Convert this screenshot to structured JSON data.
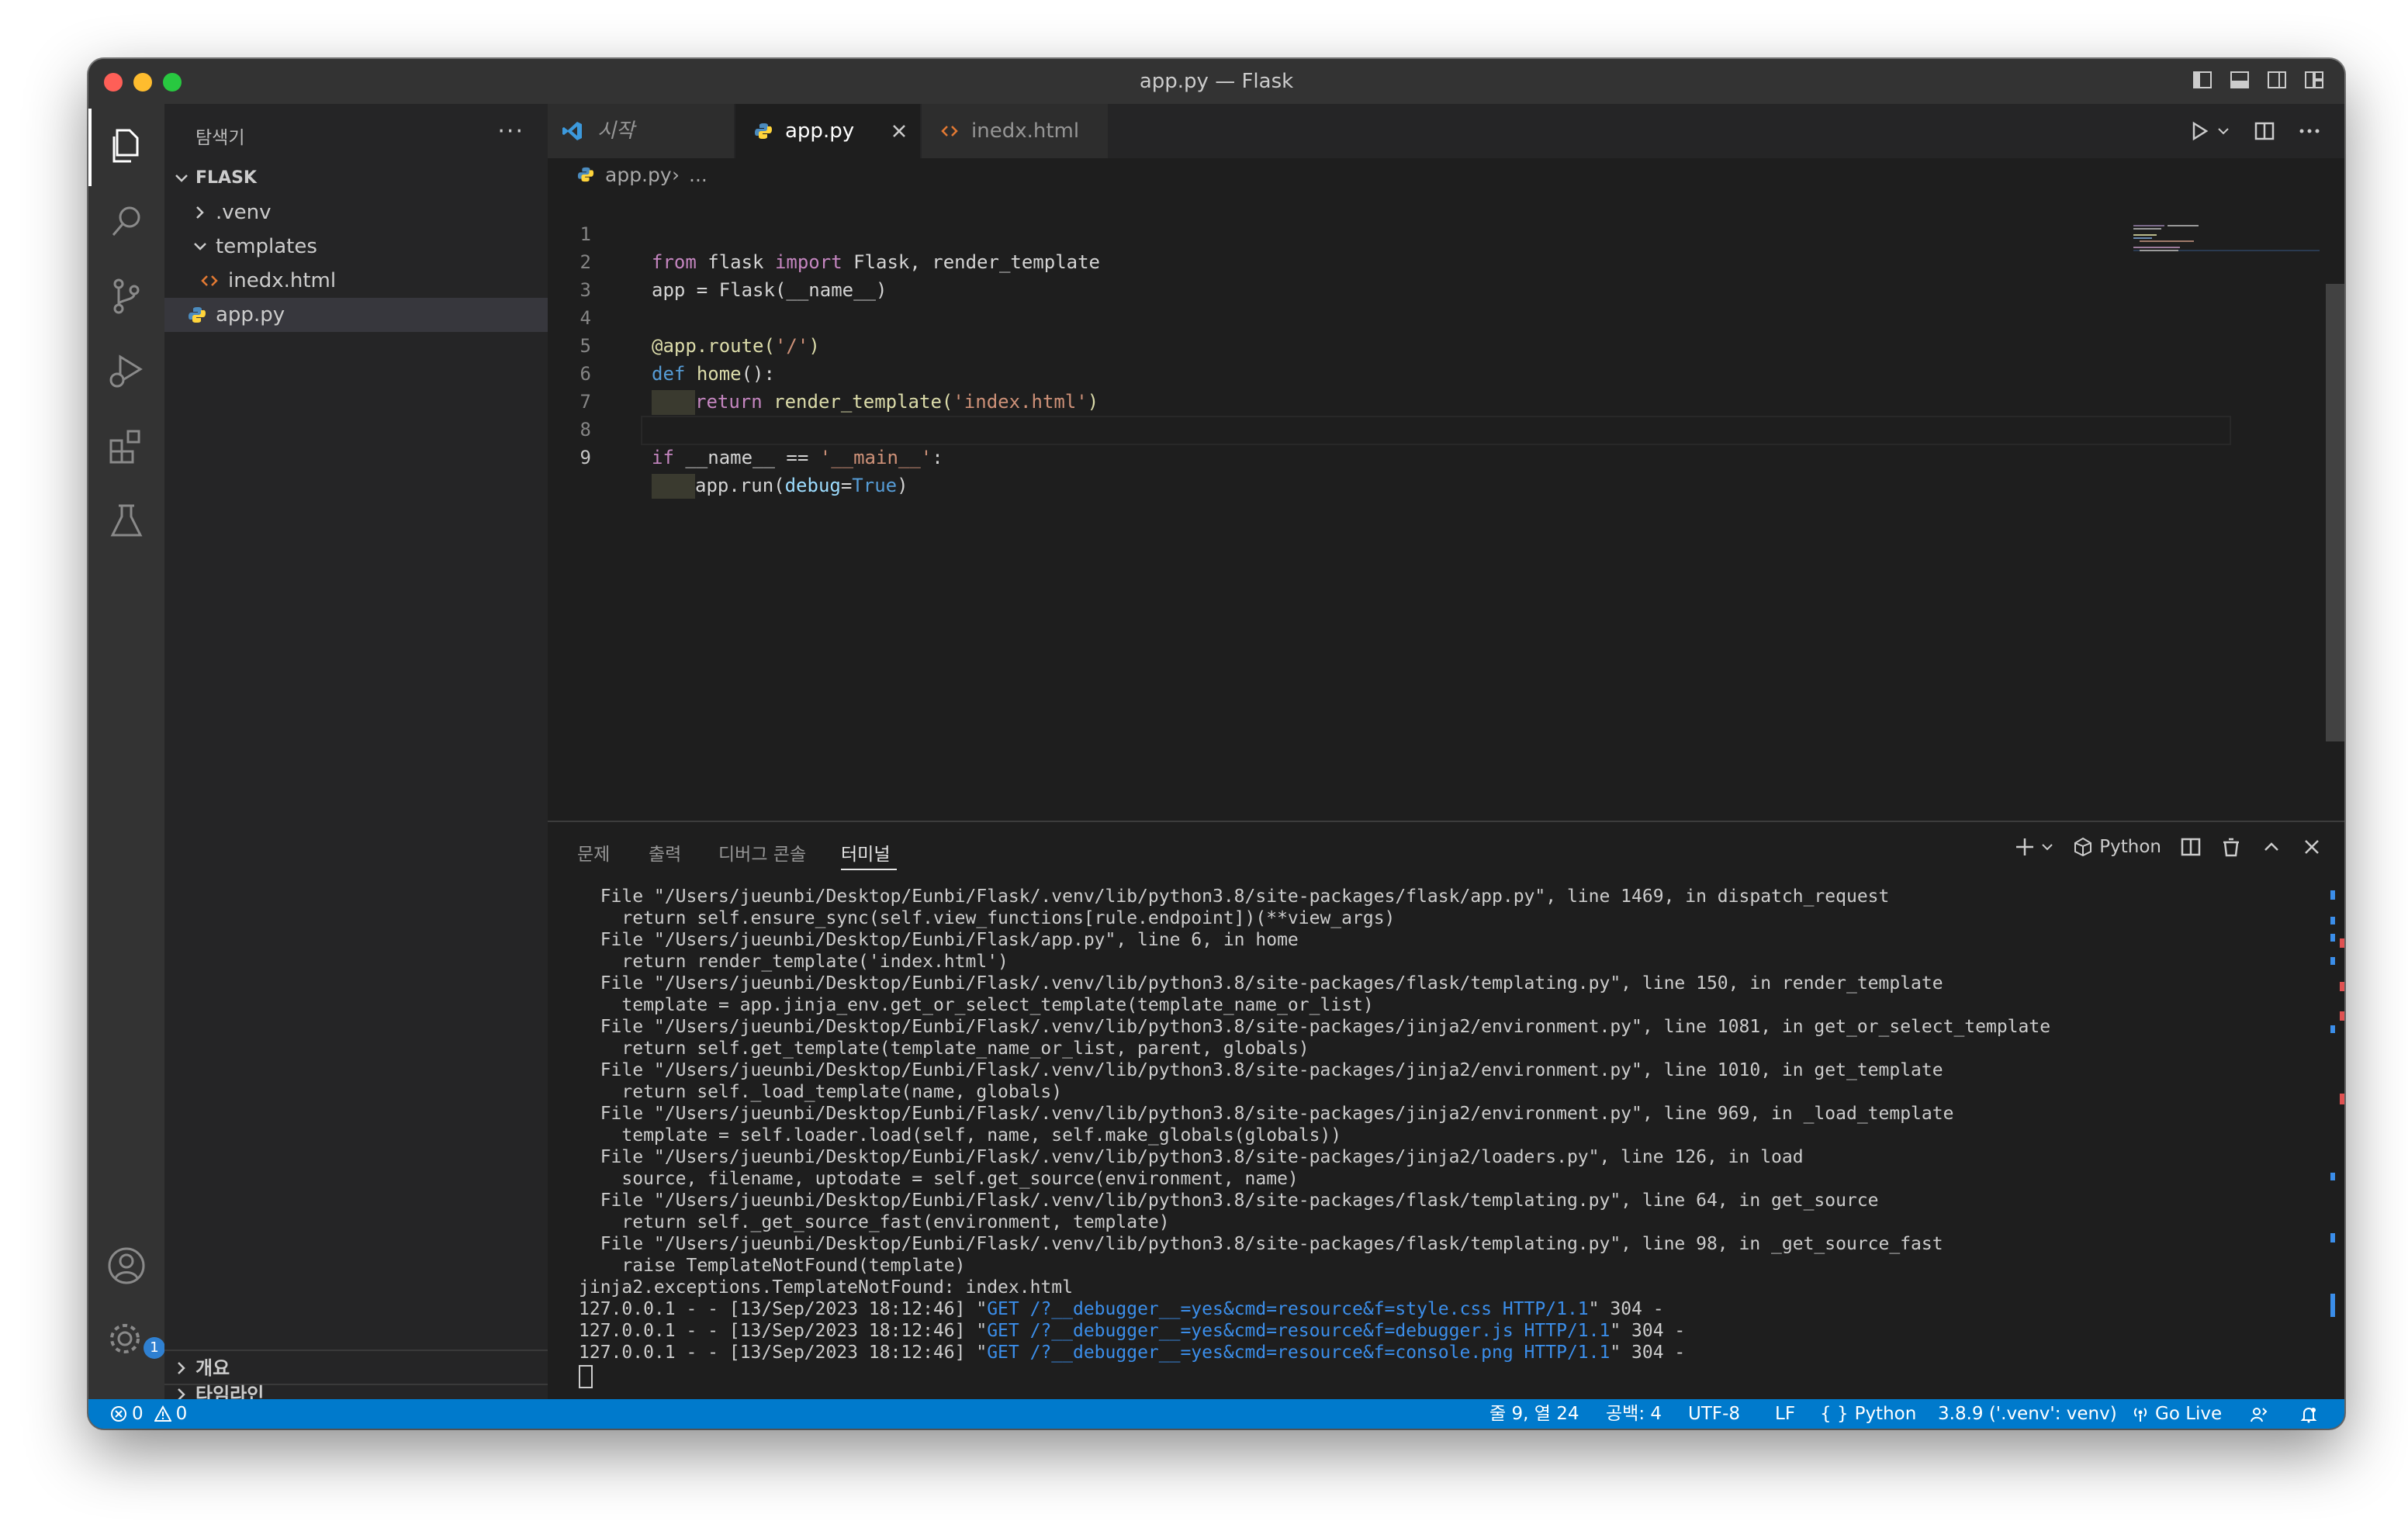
{
  "window": {
    "title": "app.py — Flask"
  },
  "sidebar": {
    "header": "탐색기",
    "more": "···",
    "root_folder": "FLASK",
    "items": [
      {
        "label": ".venv",
        "kind": "folder-collapsed"
      },
      {
        "label": "templates",
        "kind": "folder-expanded"
      },
      {
        "label": "inedx.html",
        "kind": "html-file"
      },
      {
        "label": "app.py",
        "kind": "python-file"
      }
    ],
    "bottom_sections": [
      "개요",
      "타임라인"
    ]
  },
  "tabs": [
    {
      "label": "시작",
      "icon": "vscode-logo-icon"
    },
    {
      "label": "app.py",
      "icon": "python-icon",
      "active": true
    },
    {
      "label": "inedx.html",
      "icon": "html-icon"
    }
  ],
  "breadcrumb": {
    "file": "app.py",
    "rest": "..."
  },
  "editor": {
    "current_line": 9,
    "line_numbers": [
      "1",
      "2",
      "3",
      "4",
      "5",
      "6",
      "7",
      "8",
      "9"
    ],
    "lines": [
      [
        "from",
        " flask ",
        "import",
        " Flask, render_template"
      ],
      [
        "app = Flask(__name__)"
      ],
      [
        ""
      ],
      [
        "@app.route(",
        "'/'",
        ")"
      ],
      [
        "def",
        " ",
        "home",
        "():"
      ],
      [
        "return",
        " ",
        "render_template",
        "(",
        "'index.html'",
        ")"
      ],
      [
        ""
      ],
      [
        "if",
        " __name__ == ",
        "'__main__'",
        ":"
      ],
      [
        "app.run(",
        "debug",
        "=",
        "True",
        ")"
      ]
    ]
  },
  "panel": {
    "tabs": [
      "문제",
      "출력",
      "디버그 콘솔",
      "터미널"
    ],
    "active_tab": "터미널",
    "shell": "Python",
    "terminal_lines": [
      "  File \"/Users/jueunbi/Desktop/Eunbi/Flask/.venv/lib/python3.8/site-packages/flask/app.py\", line 1469, in dispatch_request",
      "    return self.ensure_sync(self.view_functions[rule.endpoint])(**view_args)",
      "  File \"/Users/jueunbi/Desktop/Eunbi/Flask/app.py\", line 6, in home",
      "    return render_template('index.html')",
      "  File \"/Users/jueunbi/Desktop/Eunbi/Flask/.venv/lib/python3.8/site-packages/flask/templating.py\", line 150, in render_template",
      "    template = app.jinja_env.get_or_select_template(template_name_or_list)",
      "  File \"/Users/jueunbi/Desktop/Eunbi/Flask/.venv/lib/python3.8/site-packages/jinja2/environment.py\", line 1081, in get_or_select_template",
      "    return self.get_template(template_name_or_list, parent, globals)",
      "  File \"/Users/jueunbi/Desktop/Eunbi/Flask/.venv/lib/python3.8/site-packages/jinja2/environment.py\", line 1010, in get_template",
      "    return self._load_template(name, globals)",
      "  File \"/Users/jueunbi/Desktop/Eunbi/Flask/.venv/lib/python3.8/site-packages/jinja2/environment.py\", line 969, in _load_template",
      "    template = self.loader.load(self, name, self.make_globals(globals))",
      "  File \"/Users/jueunbi/Desktop/Eunbi/Flask/.venv/lib/python3.8/site-packages/jinja2/loaders.py\", line 126, in load",
      "    source, filename, uptodate = self.get_source(environment, name)",
      "  File \"/Users/jueunbi/Desktop/Eunbi/Flask/.venv/lib/python3.8/site-packages/flask/templating.py\", line 64, in get_source",
      "    return self._get_source_fast(environment, template)",
      "  File \"/Users/jueunbi/Desktop/Eunbi/Flask/.venv/lib/python3.8/site-packages/flask/templating.py\", line 98, in _get_source_fast",
      "    raise TemplateNotFound(template)",
      "jinja2.exceptions.TemplateNotFound: index.html"
    ],
    "request_lines": [
      {
        "prefix": "127.0.0.1 - - [13/Sep/2023 18:12:46] \"",
        "request": "GET /?__debugger__=yes&cmd=resource&f=style.css HTTP/1.1",
        "suffix": "\" 304 -"
      },
      {
        "prefix": "127.0.0.1 - - [13/Sep/2023 18:12:46] \"",
        "request": "GET /?__debugger__=yes&cmd=resource&f=debugger.js HTTP/1.1",
        "suffix": "\" 304 -"
      },
      {
        "prefix": "127.0.0.1 - - [13/Sep/2023 18:12:46] \"",
        "request": "GET /?__debugger__=yes&cmd=resource&f=console.png HTTP/1.1",
        "suffix": "\" 304 -"
      }
    ]
  },
  "statusbar": {
    "errors": "0",
    "warnings": "0",
    "position": "줄 9, 열 24",
    "spaces": "공백: 4",
    "encoding": "UTF-8",
    "eol": "LF",
    "language": "Python",
    "interpreter": "3.8.9 ('.venv': venv)",
    "golive": "Go Live"
  },
  "activity": {
    "settings_badge": "1"
  },
  "colors": {
    "accent": "#007acc",
    "editor_bg": "#1e1e1e",
    "sidebar_bg": "#252526"
  }
}
